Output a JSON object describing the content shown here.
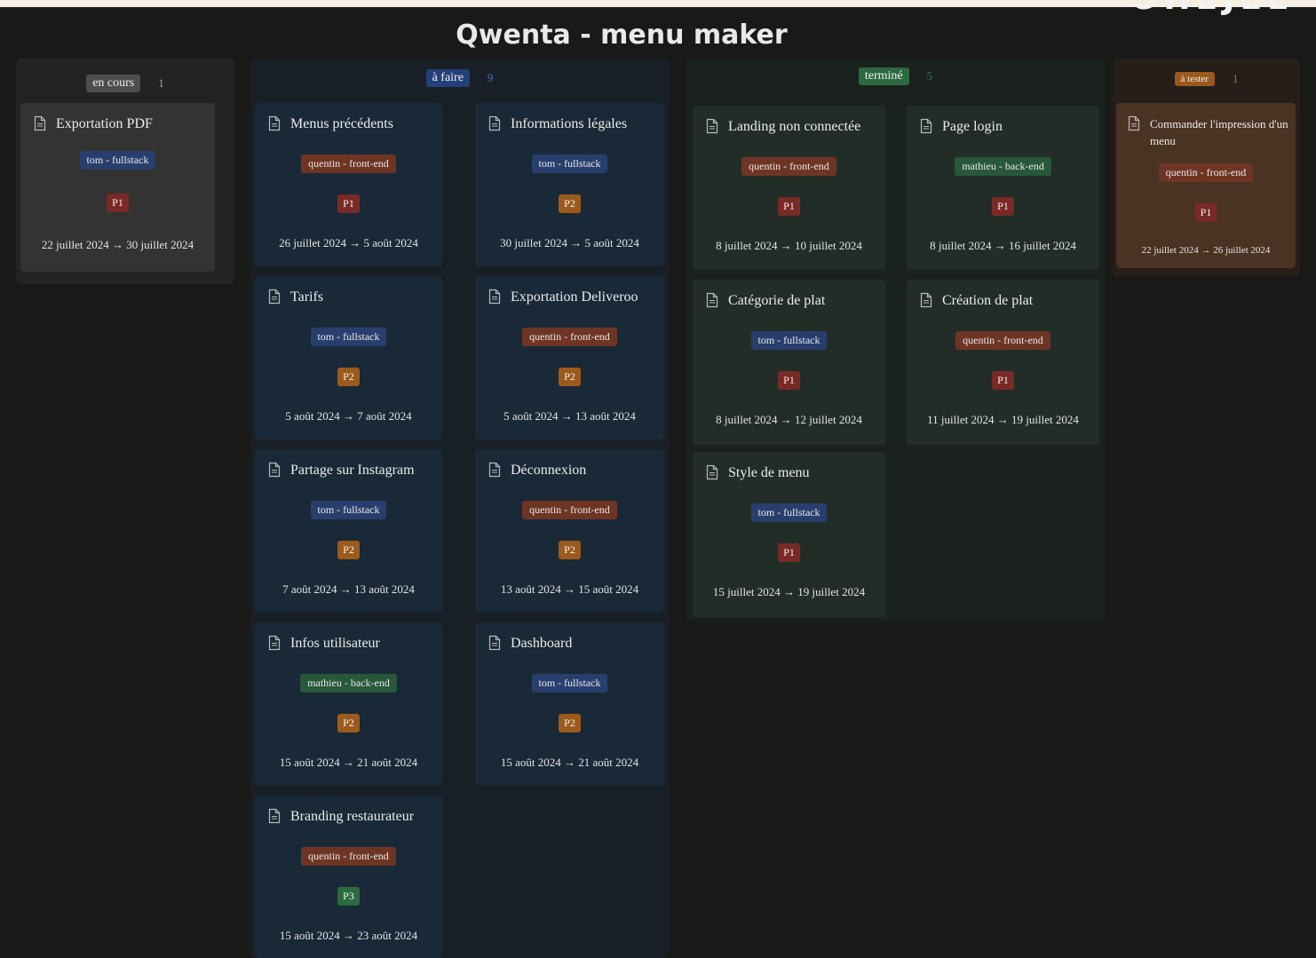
{
  "page": {
    "title": "Qwenta - menu maker",
    "corner_text": "ЭHEJEL"
  },
  "columns": [
    {
      "status": "en cours",
      "count": "1",
      "colors": {
        "col_bg": "#232322",
        "card_bg": "#333332",
        "badge_bg": "#4d4d4b",
        "count": "#999999"
      },
      "cards": [
        {
          "title": "Exportation PDF",
          "assignee": "tom - fullstack",
          "assignee_type": "fullstack",
          "priority": "P1",
          "dates": "22 juillet 2024 → 30 juillet 2024"
        }
      ]
    },
    {
      "status": "à faire",
      "count": "9",
      "colors": {
        "col_bg": "#181f26",
        "card_bg": "#1a2937",
        "badge_bg": "#24407a",
        "count": "#4a74bd"
      },
      "cards": [
        {
          "title": "Menus précédents",
          "assignee": "quentin - front-end",
          "assignee_type": "frontend",
          "priority": "P1",
          "dates": "26 juillet 2024 → 5 août 2024"
        },
        {
          "title": "Informations légales",
          "assignee": "tom - fullstack",
          "assignee_type": "fullstack",
          "priority": "P2",
          "dates": "30 juillet 2024 → 5 août 2024"
        },
        {
          "title": "Tarifs",
          "assignee": "tom - fullstack",
          "assignee_type": "fullstack",
          "priority": "P2",
          "dates": "5 août 2024 → 7 août 2024"
        },
        {
          "title": "Exportation Deliveroo",
          "assignee": "quentin - front-end",
          "assignee_type": "frontend",
          "priority": "P2",
          "dates": "5 août 2024 → 13 août 2024"
        },
        {
          "title": "Partage sur Instagram",
          "assignee": "tom - fullstack",
          "assignee_type": "fullstack",
          "priority": "P2",
          "dates": "7 août 2024 → 13 août 2024"
        },
        {
          "title": "Déconnexion",
          "assignee": "quentin - front-end",
          "assignee_type": "frontend",
          "priority": "P2",
          "dates": "13 août 2024 → 15 août 2024"
        },
        {
          "title": "Infos utilisateur",
          "assignee": "mathieu - back-end",
          "assignee_type": "backend",
          "priority": "P2",
          "dates": "15 août 2024 → 21 août 2024"
        },
        {
          "title": "Dashboard",
          "assignee": "tom - fullstack",
          "assignee_type": "fullstack",
          "priority": "P2",
          "dates": "15 août 2024 → 21 août 2024"
        },
        {
          "title": "Branding restaurateur",
          "assignee": "quentin - front-end",
          "assignee_type": "frontend",
          "priority": "P3",
          "dates": "15 août 2024 → 23 août 2024"
        }
      ]
    },
    {
      "status": "terminé",
      "count": "5",
      "colors": {
        "col_bg": "#1b211e",
        "card_bg": "#232d28",
        "badge_bg": "#2c6a40",
        "count": "#3c7a4e"
      },
      "cards": [
        {
          "title": "Landing non connectée",
          "assignee": "quentin - front-end",
          "assignee_type": "frontend",
          "priority": "P1",
          "dates": "8 juillet 2024 → 10 juillet 2024"
        },
        {
          "title": "Page login",
          "assignee": "mathieu - back-end",
          "assignee_type": "backend",
          "priority": "P1",
          "dates": "8 juillet 2024 → 16 juillet 2024"
        },
        {
          "title": "Catégorie de plat",
          "assignee": "tom - fullstack",
          "assignee_type": "fullstack",
          "priority": "P1",
          "dates": "8 juillet 2024 → 12 juillet 2024"
        },
        {
          "title": "Création de plat",
          "assignee": "quentin - front-end",
          "assignee_type": "frontend",
          "priority": "P1",
          "dates": "11 juillet 2024 → 19 juillet 2024"
        },
        {
          "title": "Style de menu",
          "assignee": "tom - fullstack",
          "assignee_type": "fullstack",
          "priority": "P1",
          "dates": "15 juillet 2024 → 19 juillet 2024"
        }
      ]
    },
    {
      "status": "à tester",
      "count": "1",
      "colors": {
        "col_bg": "#261e18",
        "card_bg": "#4a3322",
        "badge_bg": "#9a5a1e",
        "count": "#b06a2a"
      },
      "cards": [
        {
          "title": "Commander l'impression d'un menu",
          "assignee": "quentin - front-end",
          "assignee_type": "frontend",
          "priority": "P1",
          "dates": "22 juillet 2024 → 26 juillet 2024"
        }
      ]
    }
  ],
  "tag_colors": {
    "fullstack": "#283f6e",
    "frontend": "#6e3524",
    "backend": "#28583a"
  },
  "priority_colors": {
    "P1": "#7a2a26",
    "P2": "#9c5a1c",
    "P3": "#2c6a40"
  }
}
